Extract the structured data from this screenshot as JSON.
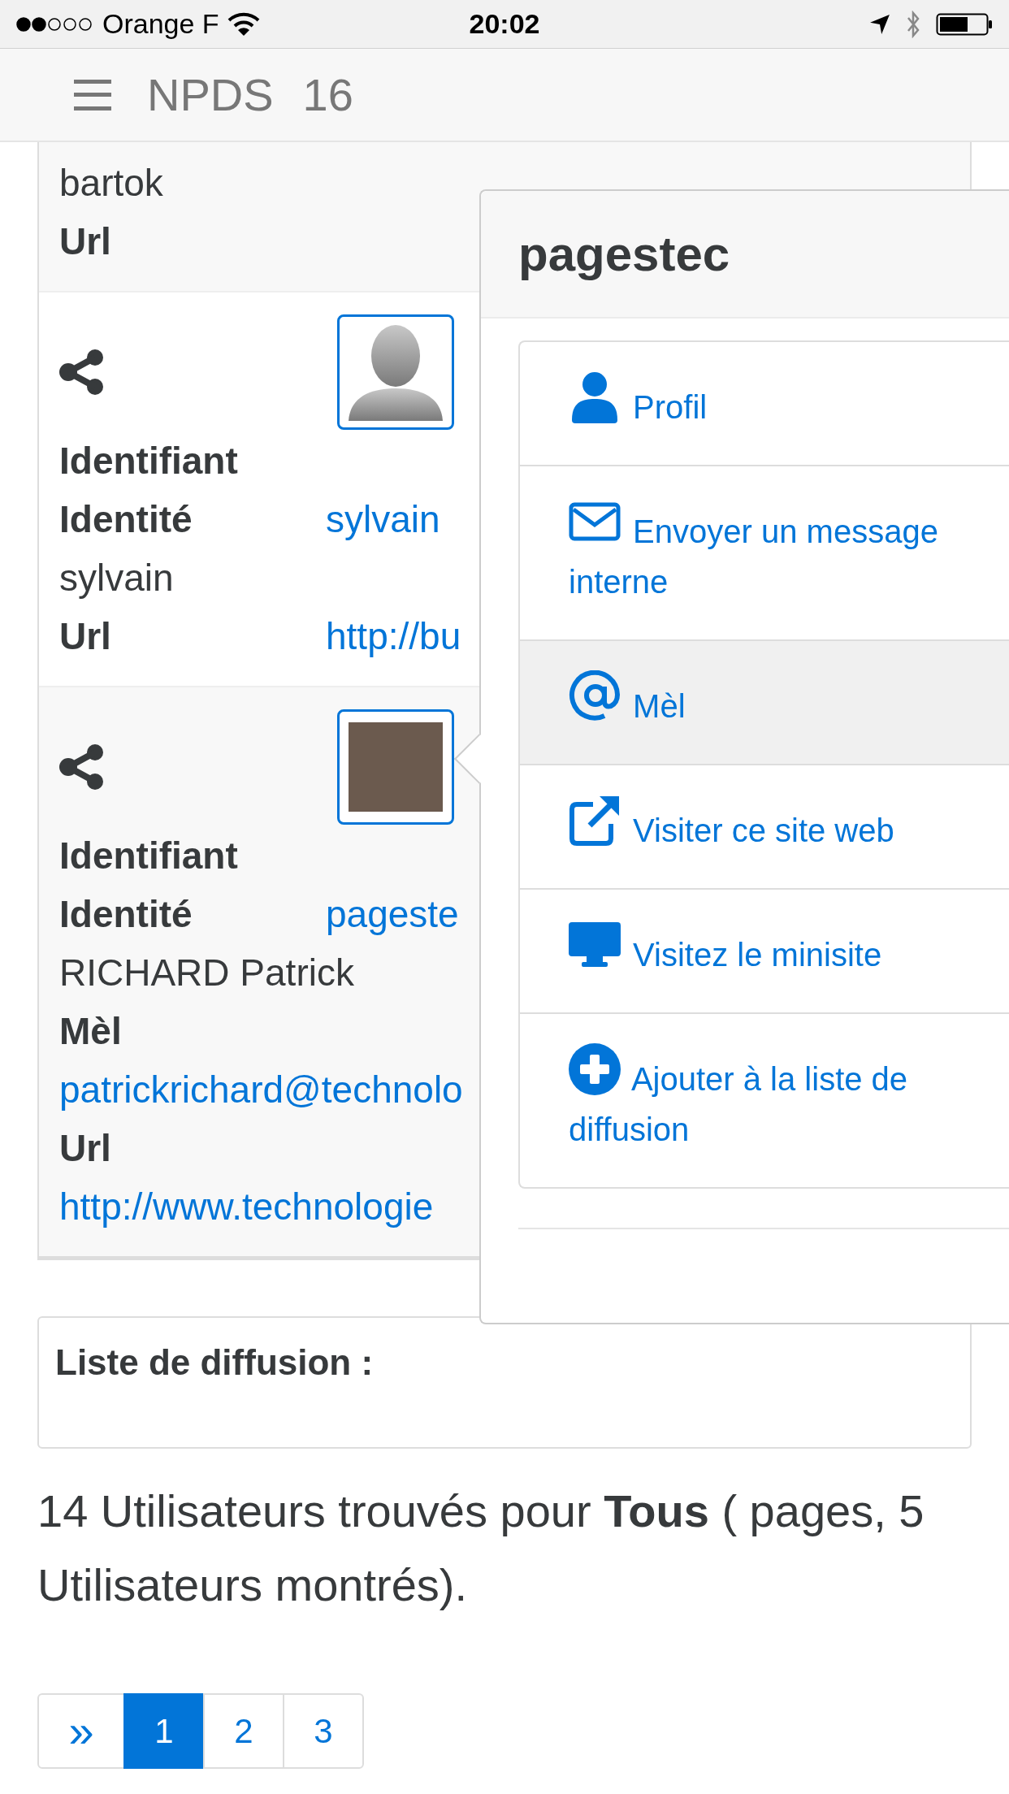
{
  "status_bar": {
    "carrier": "Orange F",
    "time": "20:02"
  },
  "navbar": {
    "brand": "NPDS",
    "version": "16"
  },
  "members": [
    {
      "kind": "plain",
      "lines": [
        {
          "kind": "text",
          "text": "bartok"
        },
        {
          "kind": "label",
          "text": "Url"
        }
      ]
    },
    {
      "kind": "silhouette",
      "lines": [
        {
          "kind": "label",
          "text": "Identifiant"
        },
        {
          "kind": "pair",
          "text": "Identité",
          "value": "sylvain"
        },
        {
          "kind": "text",
          "text": "sylvain"
        },
        {
          "kind": "pair",
          "text": "Url",
          "value": "http://bu"
        }
      ]
    },
    {
      "kind": "photo",
      "lines": [
        {
          "kind": "label",
          "text": "Identifiant"
        },
        {
          "kind": "pair",
          "text": "Identité",
          "value": "pageste"
        },
        {
          "kind": "text",
          "text": "RICHARD Patrick"
        },
        {
          "kind": "label",
          "text": "Mèl"
        },
        {
          "kind": "link",
          "text": "patrickrichard@technolo"
        },
        {
          "kind": "label",
          "text": "Url"
        },
        {
          "kind": "link",
          "text": "http://www.technologie"
        }
      ]
    }
  ],
  "popover": {
    "title": "pagestec",
    "items": [
      {
        "kind": "user",
        "label": "Profil",
        "selected": false
      },
      {
        "kind": "envelope",
        "label": "Envoyer un message interne",
        "selected": false
      },
      {
        "kind": "at",
        "label": "Mèl",
        "selected": true
      },
      {
        "kind": "external",
        "label": "Visiter ce site web",
        "selected": false
      },
      {
        "kind": "desktop",
        "label": "Visitez le minisite",
        "selected": false
      },
      {
        "kind": "plus",
        "label": "Ajouter à la liste de diffusion",
        "selected": false
      }
    ]
  },
  "panel": {
    "title": "Liste de diffusion :"
  },
  "summary": "14 Utilisateurs trouvés pour **Tous** ( pages, 5 Utilisateurs montrés).",
  "pagination": [
    {
      "label": "»",
      "selected": false
    },
    {
      "label": "1",
      "selected": true
    },
    {
      "label": "2",
      "selected": false
    },
    {
      "label": "3",
      "selected": false
    }
  ]
}
